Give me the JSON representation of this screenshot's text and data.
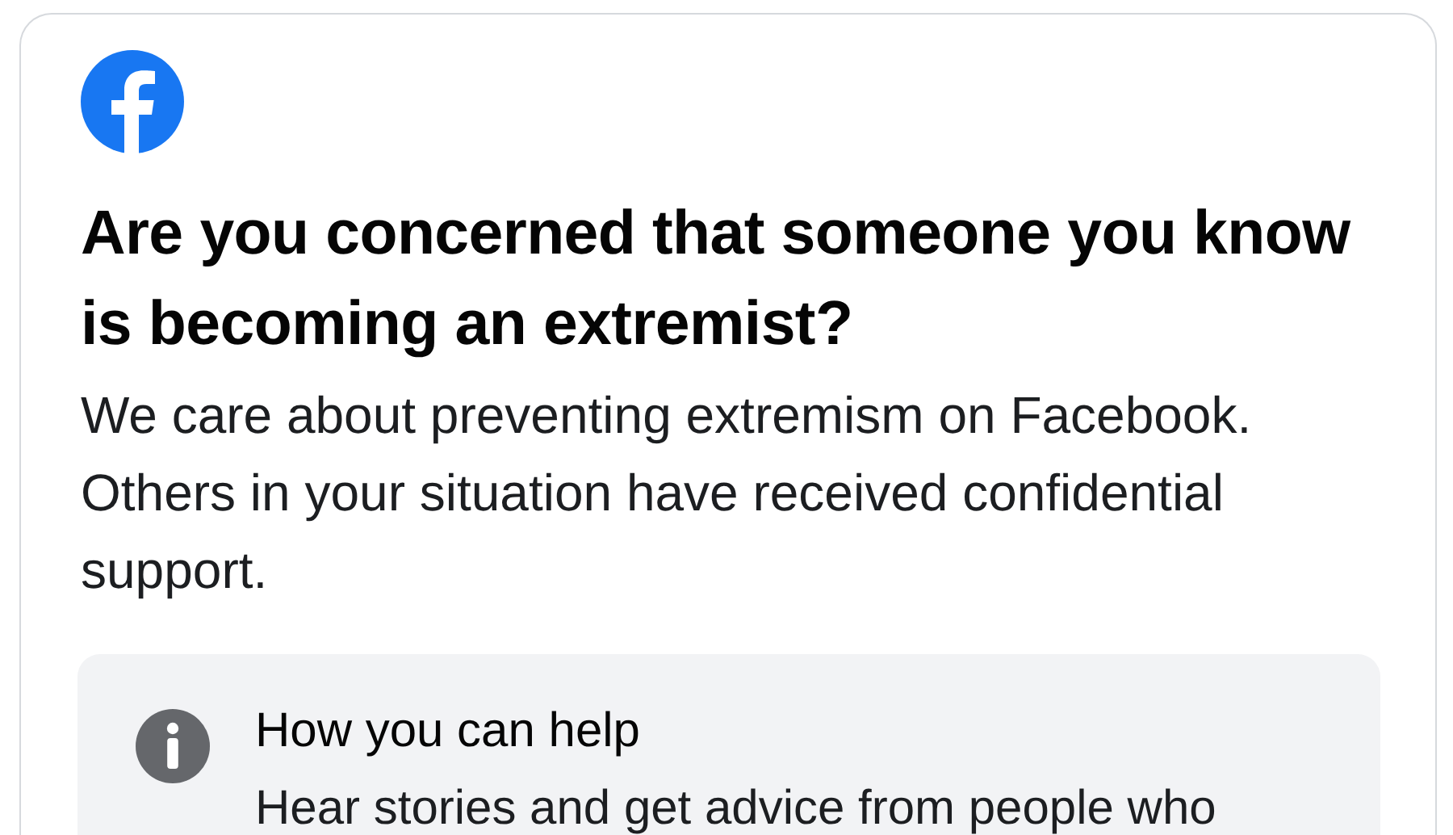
{
  "dialog": {
    "title": "Are you concerned that someone you know is becoming an extremist?",
    "message": "We care about preventing extremism on Facebook. Others in your situation have received confidential support.",
    "info_card": {
      "title": "How you can help",
      "text": "Hear stories and get advice from people who"
    }
  }
}
